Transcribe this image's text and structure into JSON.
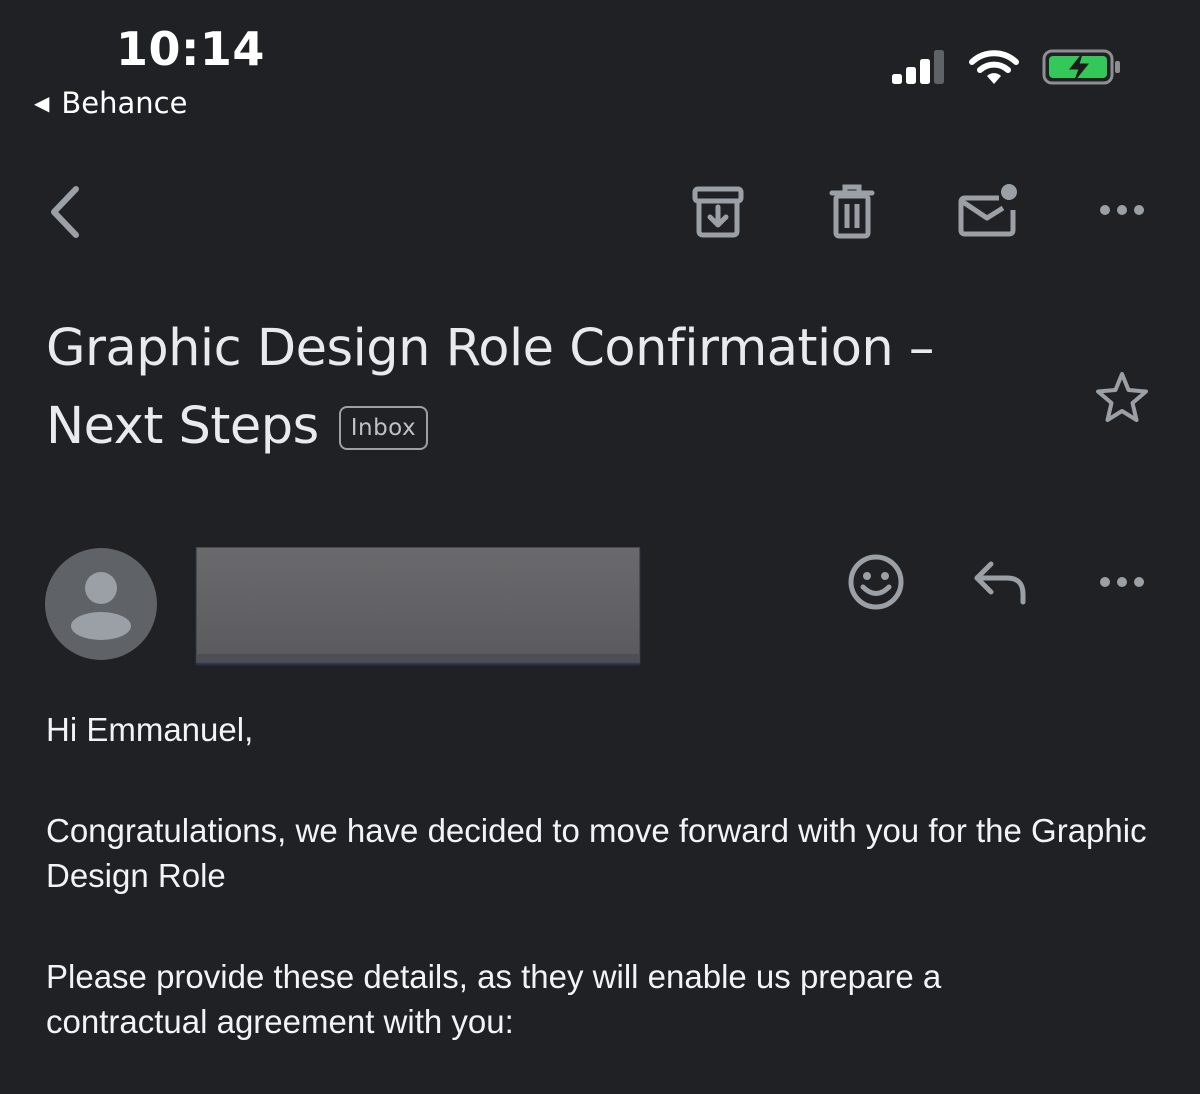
{
  "status_bar": {
    "time": "10:14",
    "back_app_label": "Behance",
    "back_app_icon": "back-triangle-icon",
    "battery_color": "#34c759"
  },
  "toolbar": {
    "icons": [
      "back-chevron-icon",
      "archive-icon",
      "delete-icon",
      "mark-unread-icon",
      "more-icon"
    ]
  },
  "message": {
    "subject": "Graphic Design Role Confirmation – Next Steps",
    "label_chip": "Inbox",
    "starred": false
  },
  "sender": {
    "avatar_icon": "person-icon",
    "name_redacted": true,
    "actions": [
      "emoji-reaction-icon",
      "reply-icon",
      "more-icon"
    ]
  },
  "body": {
    "greeting": "Hi Emmanuel,",
    "paragraphs": [
      "Congratulations, we have decided to move forward with you for the Graphic Design Role",
      "Please provide these details, as they will enable us prepare a contractual agreement with you:"
    ]
  },
  "colors": {
    "background": "#202124",
    "icon": "#9aa0a6",
    "text": "#e8eaed"
  }
}
